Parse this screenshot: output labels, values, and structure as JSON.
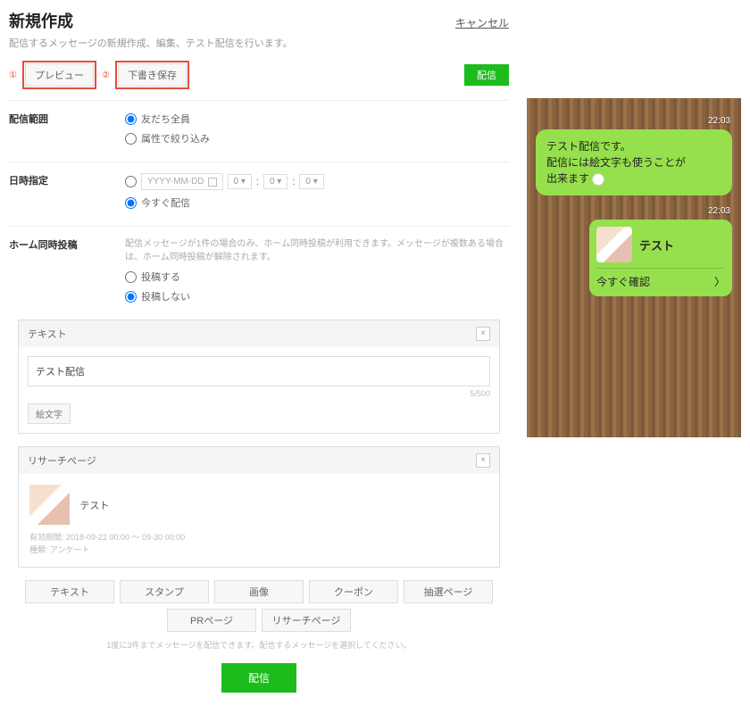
{
  "header": {
    "title": "新規作成",
    "cancel": "キャンセル",
    "subtitle": "配信するメッセージの新規作成、編集、テスト配信を行います。"
  },
  "top_actions": {
    "num1": "①",
    "num2": "②",
    "preview": "プレビュー",
    "save_draft": "下書き保存",
    "send": "配信"
  },
  "range": {
    "label": "配信範囲",
    "opt1": "友だち全員",
    "opt2": "属性で絞り込み"
  },
  "schedule": {
    "label": "日時指定",
    "date_placeholder": "YYYY-MM-DD",
    "h": "0",
    "m": "0",
    "s": "0",
    "opt_now": "今すぐ配信"
  },
  "timeline": {
    "label": "ホーム同時投稿",
    "hint": "配信メッセージが1件の場合のみ、ホーム同時投稿が利用できます。メッセージが複数ある場合は、ホーム同時投稿が解除されます。",
    "opt_post": "投稿する",
    "opt_nopost": "投稿しない"
  },
  "text_panel": {
    "head": "テキスト",
    "value": "テスト配信",
    "char_count": "5/500",
    "emoji_btn": "絵文字"
  },
  "research_panel": {
    "head": "リサーチページ",
    "title": "テスト",
    "period": "有効期間: 2018-09-22 00:00 ～ 09-30 00:00",
    "type": "種類: アンケート"
  },
  "buttons": {
    "b1": "テキスト",
    "b2": "スタンプ",
    "b3": "画像",
    "b4": "クーポン",
    "b5": "抽選ページ",
    "b6": "PRページ",
    "b7": "リサーチページ",
    "hint": "1度に3件までメッセージを配信できます。配信するメッセージを選択してください。"
  },
  "bottom": {
    "send": "配信"
  },
  "preview": {
    "time1": "22:03",
    "msg1_l1": "テスト配信です。",
    "msg1_l2": "配信には絵文字も使うことが",
    "msg1_l3": "出来ます",
    "time2": "22:03",
    "card_title": "テスト",
    "card_btn": "今すぐ確認",
    "arrow": "〉"
  }
}
